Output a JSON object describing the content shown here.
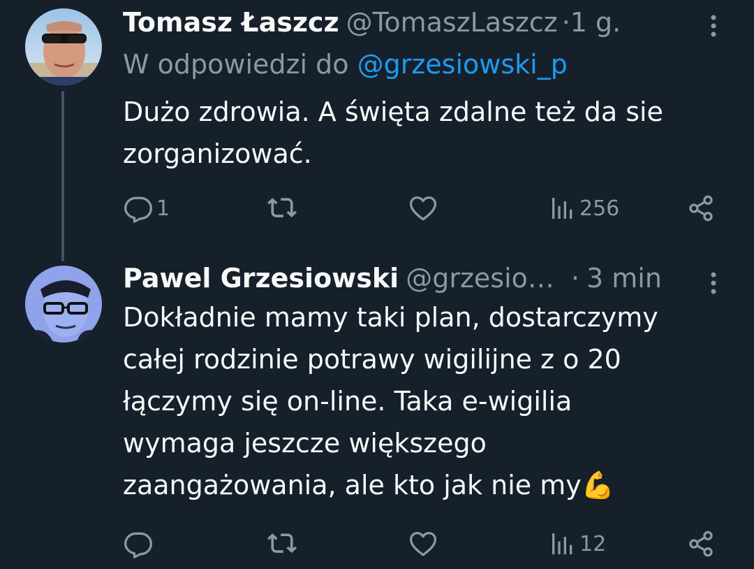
{
  "tweets": [
    {
      "display_name": "Tomasz Łaszcz",
      "handle": "@TomaszLaszcz",
      "separator": "·",
      "time": "1 g.",
      "reply_prefix": "W odpowiedzi do",
      "reply_to": "@grzesiowski_p",
      "text": "Dużo zdrowia. A święta zdalne też da sie\nzorganizować.",
      "reply_count": "1",
      "retweet_count": "",
      "like_count": "",
      "view_count": "256",
      "avatar_icon": "person-photo-sunglasses"
    },
    {
      "display_name": "Pawel Grzesiowski",
      "handle": "@grzesio…",
      "separator": "·",
      "time": "3 min",
      "text": "Dokładnie mamy taki plan, dostarczymy\ncałej rodzinie potrawy wigilijne z o 20\nłączymy się on-line. Taka e-wigilia\nwymaga jeszcze większego\nzaangażowania, ale kto jak nie my💪",
      "reply_count": "",
      "retweet_count": "",
      "like_count": "",
      "view_count": "12",
      "avatar_icon": "person-photo-glasses-blue"
    }
  ],
  "icons": {
    "reply": "reply-icon",
    "retweet": "retweet-icon",
    "like": "heart-icon",
    "views": "views-icon",
    "share": "share-icon",
    "more": "more-vertical-icon"
  },
  "colors": {
    "background": "#15202b",
    "text_primary": "#f7f9f9",
    "text_secondary": "#8b98a5",
    "link": "#1d9bf0",
    "thread_line": "#425364"
  }
}
